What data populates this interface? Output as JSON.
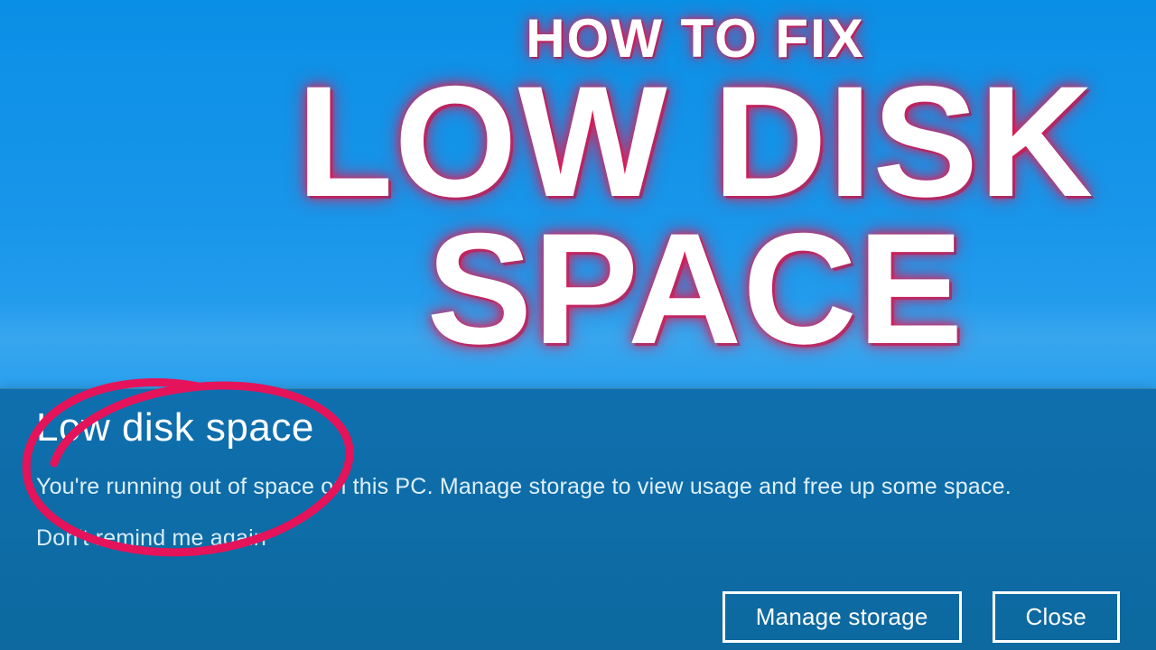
{
  "colors": {
    "accent_pink": "#e5135a",
    "win_blue_panel": "#0e6aa3",
    "bg_gradient_top": "#0a8fe6",
    "bg_gradient_bottom": "#40afef"
  },
  "thumbnail": {
    "overline": "HOW TO FIX",
    "headline_line1": "LOW DISK",
    "headline_line2": "SPACE"
  },
  "notification": {
    "title": "Low disk space",
    "body": "You're running out of space on this PC. Manage storage to view usage and free up some space.",
    "dont_remind_link": "Don't remind me again",
    "buttons": {
      "manage": "Manage storage",
      "close": "Close"
    }
  }
}
